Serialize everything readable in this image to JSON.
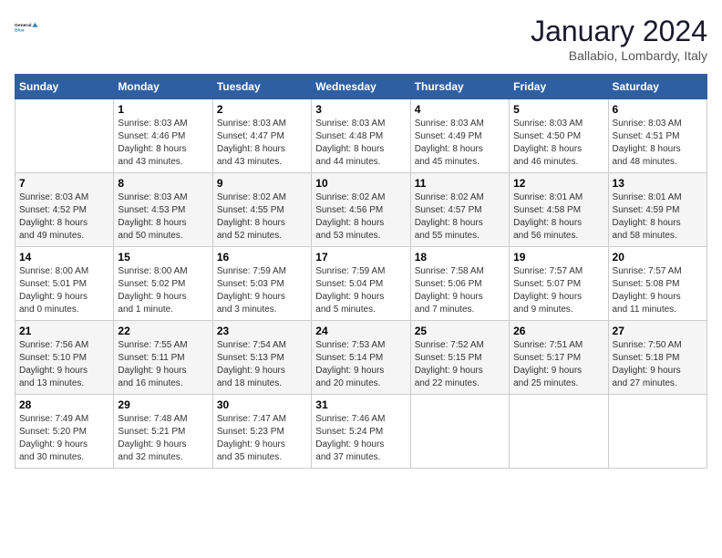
{
  "header": {
    "logo_line1": "General",
    "logo_line2": "Blue",
    "month": "January 2024",
    "location": "Ballabio, Lombardy, Italy"
  },
  "days_of_week": [
    "Sunday",
    "Monday",
    "Tuesday",
    "Wednesday",
    "Thursday",
    "Friday",
    "Saturday"
  ],
  "weeks": [
    [
      {
        "num": "",
        "info": ""
      },
      {
        "num": "1",
        "info": "Sunrise: 8:03 AM\nSunset: 4:46 PM\nDaylight: 8 hours\nand 43 minutes."
      },
      {
        "num": "2",
        "info": "Sunrise: 8:03 AM\nSunset: 4:47 PM\nDaylight: 8 hours\nand 43 minutes."
      },
      {
        "num": "3",
        "info": "Sunrise: 8:03 AM\nSunset: 4:48 PM\nDaylight: 8 hours\nand 44 minutes."
      },
      {
        "num": "4",
        "info": "Sunrise: 8:03 AM\nSunset: 4:49 PM\nDaylight: 8 hours\nand 45 minutes."
      },
      {
        "num": "5",
        "info": "Sunrise: 8:03 AM\nSunset: 4:50 PM\nDaylight: 8 hours\nand 46 minutes."
      },
      {
        "num": "6",
        "info": "Sunrise: 8:03 AM\nSunset: 4:51 PM\nDaylight: 8 hours\nand 48 minutes."
      }
    ],
    [
      {
        "num": "7",
        "info": "Sunrise: 8:03 AM\nSunset: 4:52 PM\nDaylight: 8 hours\nand 49 minutes."
      },
      {
        "num": "8",
        "info": "Sunrise: 8:03 AM\nSunset: 4:53 PM\nDaylight: 8 hours\nand 50 minutes."
      },
      {
        "num": "9",
        "info": "Sunrise: 8:02 AM\nSunset: 4:55 PM\nDaylight: 8 hours\nand 52 minutes."
      },
      {
        "num": "10",
        "info": "Sunrise: 8:02 AM\nSunset: 4:56 PM\nDaylight: 8 hours\nand 53 minutes."
      },
      {
        "num": "11",
        "info": "Sunrise: 8:02 AM\nSunset: 4:57 PM\nDaylight: 8 hours\nand 55 minutes."
      },
      {
        "num": "12",
        "info": "Sunrise: 8:01 AM\nSunset: 4:58 PM\nDaylight: 8 hours\nand 56 minutes."
      },
      {
        "num": "13",
        "info": "Sunrise: 8:01 AM\nSunset: 4:59 PM\nDaylight: 8 hours\nand 58 minutes."
      }
    ],
    [
      {
        "num": "14",
        "info": "Sunrise: 8:00 AM\nSunset: 5:01 PM\nDaylight: 9 hours\nand 0 minutes."
      },
      {
        "num": "15",
        "info": "Sunrise: 8:00 AM\nSunset: 5:02 PM\nDaylight: 9 hours\nand 1 minute."
      },
      {
        "num": "16",
        "info": "Sunrise: 7:59 AM\nSunset: 5:03 PM\nDaylight: 9 hours\nand 3 minutes."
      },
      {
        "num": "17",
        "info": "Sunrise: 7:59 AM\nSunset: 5:04 PM\nDaylight: 9 hours\nand 5 minutes."
      },
      {
        "num": "18",
        "info": "Sunrise: 7:58 AM\nSunset: 5:06 PM\nDaylight: 9 hours\nand 7 minutes."
      },
      {
        "num": "19",
        "info": "Sunrise: 7:57 AM\nSunset: 5:07 PM\nDaylight: 9 hours\nand 9 minutes."
      },
      {
        "num": "20",
        "info": "Sunrise: 7:57 AM\nSunset: 5:08 PM\nDaylight: 9 hours\nand 11 minutes."
      }
    ],
    [
      {
        "num": "21",
        "info": "Sunrise: 7:56 AM\nSunset: 5:10 PM\nDaylight: 9 hours\nand 13 minutes."
      },
      {
        "num": "22",
        "info": "Sunrise: 7:55 AM\nSunset: 5:11 PM\nDaylight: 9 hours\nand 16 minutes."
      },
      {
        "num": "23",
        "info": "Sunrise: 7:54 AM\nSunset: 5:13 PM\nDaylight: 9 hours\nand 18 minutes."
      },
      {
        "num": "24",
        "info": "Sunrise: 7:53 AM\nSunset: 5:14 PM\nDaylight: 9 hours\nand 20 minutes."
      },
      {
        "num": "25",
        "info": "Sunrise: 7:52 AM\nSunset: 5:15 PM\nDaylight: 9 hours\nand 22 minutes."
      },
      {
        "num": "26",
        "info": "Sunrise: 7:51 AM\nSunset: 5:17 PM\nDaylight: 9 hours\nand 25 minutes."
      },
      {
        "num": "27",
        "info": "Sunrise: 7:50 AM\nSunset: 5:18 PM\nDaylight: 9 hours\nand 27 minutes."
      }
    ],
    [
      {
        "num": "28",
        "info": "Sunrise: 7:49 AM\nSunset: 5:20 PM\nDaylight: 9 hours\nand 30 minutes."
      },
      {
        "num": "29",
        "info": "Sunrise: 7:48 AM\nSunset: 5:21 PM\nDaylight: 9 hours\nand 32 minutes."
      },
      {
        "num": "30",
        "info": "Sunrise: 7:47 AM\nSunset: 5:23 PM\nDaylight: 9 hours\nand 35 minutes."
      },
      {
        "num": "31",
        "info": "Sunrise: 7:46 AM\nSunset: 5:24 PM\nDaylight: 9 hours\nand 37 minutes."
      },
      {
        "num": "",
        "info": ""
      },
      {
        "num": "",
        "info": ""
      },
      {
        "num": "",
        "info": ""
      }
    ]
  ]
}
